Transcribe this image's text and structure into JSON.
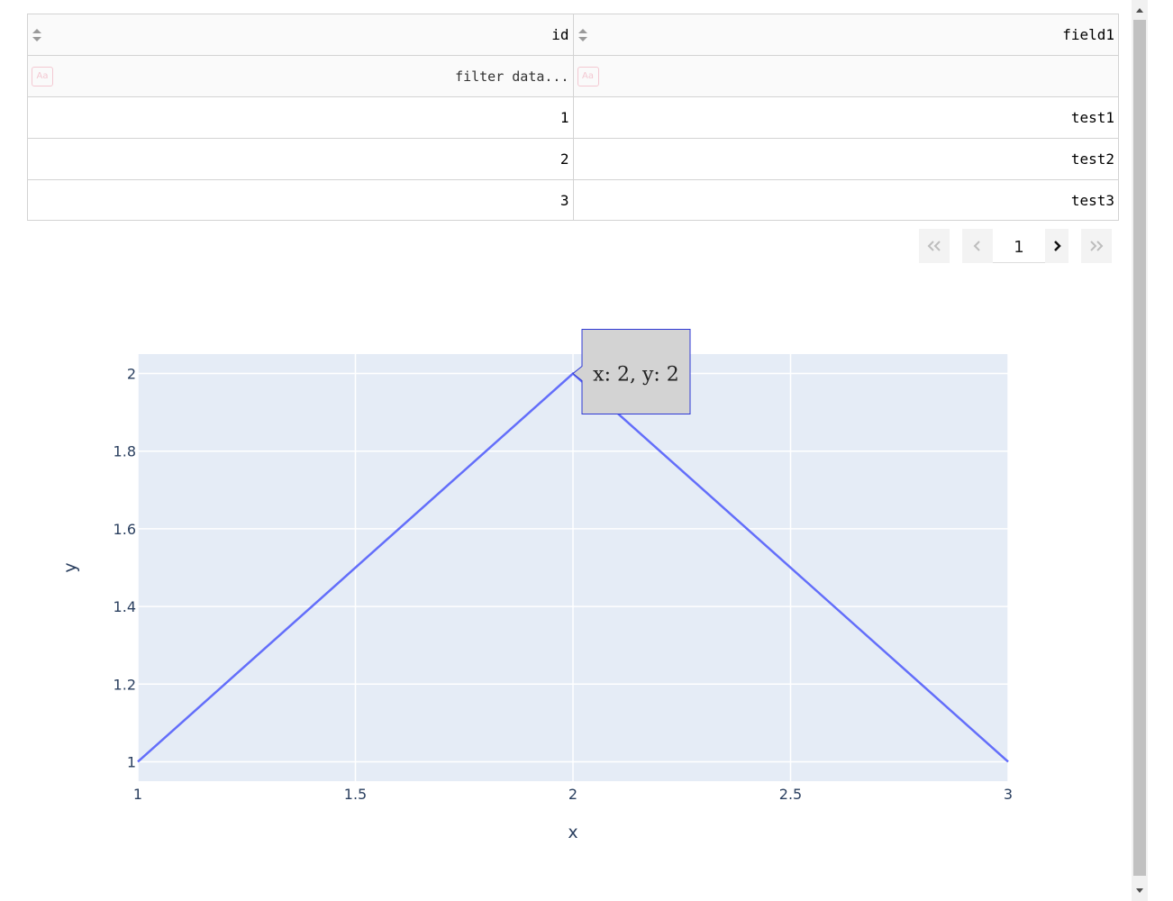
{
  "table": {
    "columns": [
      {
        "label": "id"
      },
      {
        "label": "field1"
      }
    ],
    "filter_placeholder": "filter data...",
    "filter_icon_label": "Aa",
    "rows": [
      [
        "1",
        "test1"
      ],
      [
        "2",
        "test2"
      ],
      [
        "3",
        "test3"
      ]
    ]
  },
  "pagination": {
    "current_page": "1"
  },
  "chart_data": {
    "type": "line",
    "series": [
      {
        "x": [
          1,
          2,
          3
        ],
        "y": [
          1,
          2,
          1
        ],
        "color": "#636efa"
      }
    ],
    "xlabel": "x",
    "ylabel": "y",
    "xlim": [
      1,
      3
    ],
    "ylim": [
      0.95,
      2.05
    ],
    "x_ticks": [
      1,
      1.5,
      2,
      2.5,
      3
    ],
    "y_ticks": [
      1,
      1.2,
      1.4,
      1.6,
      1.8,
      2
    ],
    "grid": true,
    "plot_bgcolor": "#e5ecf6",
    "hover": {
      "x": 2,
      "y": 2,
      "text": "x: 2, y: 2"
    }
  },
  "colors": {
    "line": "#636efa",
    "axis_text": "#2a3f5f",
    "tooltip_bg": "#d3d3d3",
    "tooltip_border": "#2f3ad6"
  }
}
